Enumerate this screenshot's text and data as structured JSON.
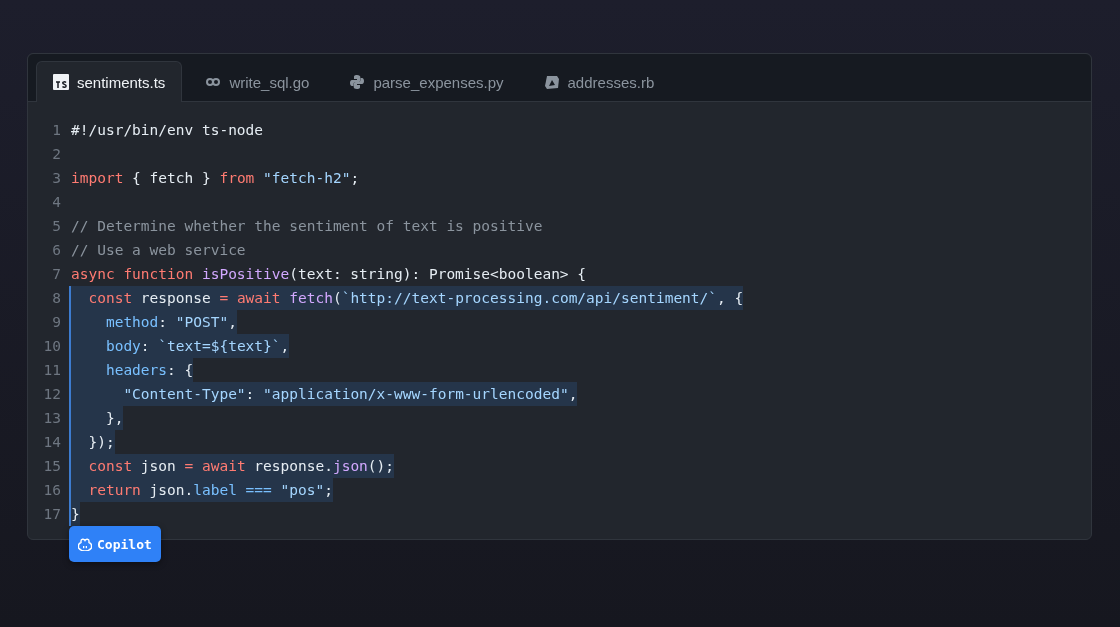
{
  "tabs": [
    {
      "label": "sentiments.ts",
      "selected": true
    },
    {
      "label": "write_sql.go",
      "selected": false
    },
    {
      "label": "parse_expenses.py",
      "selected": false
    },
    {
      "label": "addresses.rb",
      "selected": false
    }
  ],
  "code": {
    "lines": [
      {
        "number": "1",
        "suggested": false,
        "tokens": [
          {
            "text": "#!/usr/bin/env ts-node",
            "kind": "plain"
          }
        ]
      },
      {
        "number": "2",
        "suggested": false
      },
      {
        "number": "3",
        "suggested": false,
        "tokens": [
          {
            "text": "import",
            "kind": "keyword"
          },
          {
            "text": " { fetch } ",
            "kind": "plain"
          },
          {
            "text": "from",
            "kind": "keyword"
          },
          {
            "text": " \"fetch-h2\"",
            "kind": "string"
          },
          {
            "text": ";",
            "kind": "plain"
          }
        ]
      },
      {
        "number": "4",
        "suggested": false
      },
      {
        "number": "5",
        "suggested": false,
        "tokens": [
          {
            "text": "// Determine whether the sentiment of text is positive",
            "kind": "comment"
          }
        ]
      },
      {
        "number": "6",
        "suggested": false,
        "tokens": [
          {
            "text": "// Use a web service",
            "kind": "comment"
          }
        ]
      },
      {
        "number": "7",
        "suggested": false,
        "tokens": [
          {
            "text": "async function",
            "kind": "keyword"
          },
          {
            "text": " isPositive",
            "kind": "func"
          },
          {
            "text": "(text: string): Promise<boolean> {",
            "kind": "plain"
          }
        ]
      },
      {
        "number": "8",
        "suggested": true,
        "tokens": [
          {
            "text": "  const",
            "kind": "keyword"
          },
          {
            "text": " response ",
            "kind": "plain"
          },
          {
            "text": "= await",
            "kind": "keyword"
          },
          {
            "text": " fetch",
            "kind": "func"
          },
          {
            "text": "(",
            "kind": "plain"
          },
          {
            "text": "`http://text-processing.com/api/sentiment/`",
            "kind": "string"
          },
          {
            "text": ", {",
            "kind": "plain"
          }
        ]
      },
      {
        "number": "9",
        "suggested": true,
        "tokens": [
          {
            "text": "    method",
            "kind": "prop"
          },
          {
            "text": ": ",
            "kind": "plain"
          },
          {
            "text": "\"POST\"",
            "kind": "string"
          },
          {
            "text": ",",
            "kind": "plain"
          }
        ]
      },
      {
        "number": "10",
        "suggested": true,
        "tokens": [
          {
            "text": "    body",
            "kind": "prop"
          },
          {
            "text": ": ",
            "kind": "plain"
          },
          {
            "text": "`text=${text}`",
            "kind": "string"
          },
          {
            "text": ",",
            "kind": "plain"
          }
        ]
      },
      {
        "number": "11",
        "suggested": true,
        "tokens": [
          {
            "text": "    headers",
            "kind": "prop"
          },
          {
            "text": ": {",
            "kind": "plain"
          }
        ]
      },
      {
        "number": "12",
        "suggested": true,
        "tokens": [
          {
            "text": "      \"Content-Type\"",
            "kind": "string"
          },
          {
            "text": ": ",
            "kind": "plain"
          },
          {
            "text": "\"application/x-www-form-urlencoded\"",
            "kind": "string"
          },
          {
            "text": ",",
            "kind": "plain"
          }
        ]
      },
      {
        "number": "13",
        "suggested": true,
        "tokens": [
          {
            "text": "    },",
            "kind": "plain"
          }
        ]
      },
      {
        "number": "14",
        "suggested": true,
        "tokens": [
          {
            "text": "  });",
            "kind": "plain"
          }
        ]
      },
      {
        "number": "15",
        "suggested": true,
        "tokens": [
          {
            "text": "  const",
            "kind": "keyword"
          },
          {
            "text": " json ",
            "kind": "plain"
          },
          {
            "text": "= await",
            "kind": "keyword"
          },
          {
            "text": " response.",
            "kind": "plain"
          },
          {
            "text": "json",
            "kind": "func"
          },
          {
            "text": "();",
            "kind": "plain"
          }
        ]
      },
      {
        "number": "16",
        "suggested": true,
        "tokens": [
          {
            "text": "  return",
            "kind": "keyword"
          },
          {
            "text": " json.",
            "kind": "plain"
          },
          {
            "text": "label ===",
            "kind": "prop"
          },
          {
            "text": " \"pos\"",
            "kind": "string"
          },
          {
            "text": ";",
            "kind": "plain"
          }
        ]
      },
      {
        "number": "17",
        "suggested": true,
        "tokens": [
          {
            "text": "}",
            "kind": "plain"
          }
        ]
      }
    ]
  },
  "copilot_button": {
    "label": "Copilot"
  }
}
